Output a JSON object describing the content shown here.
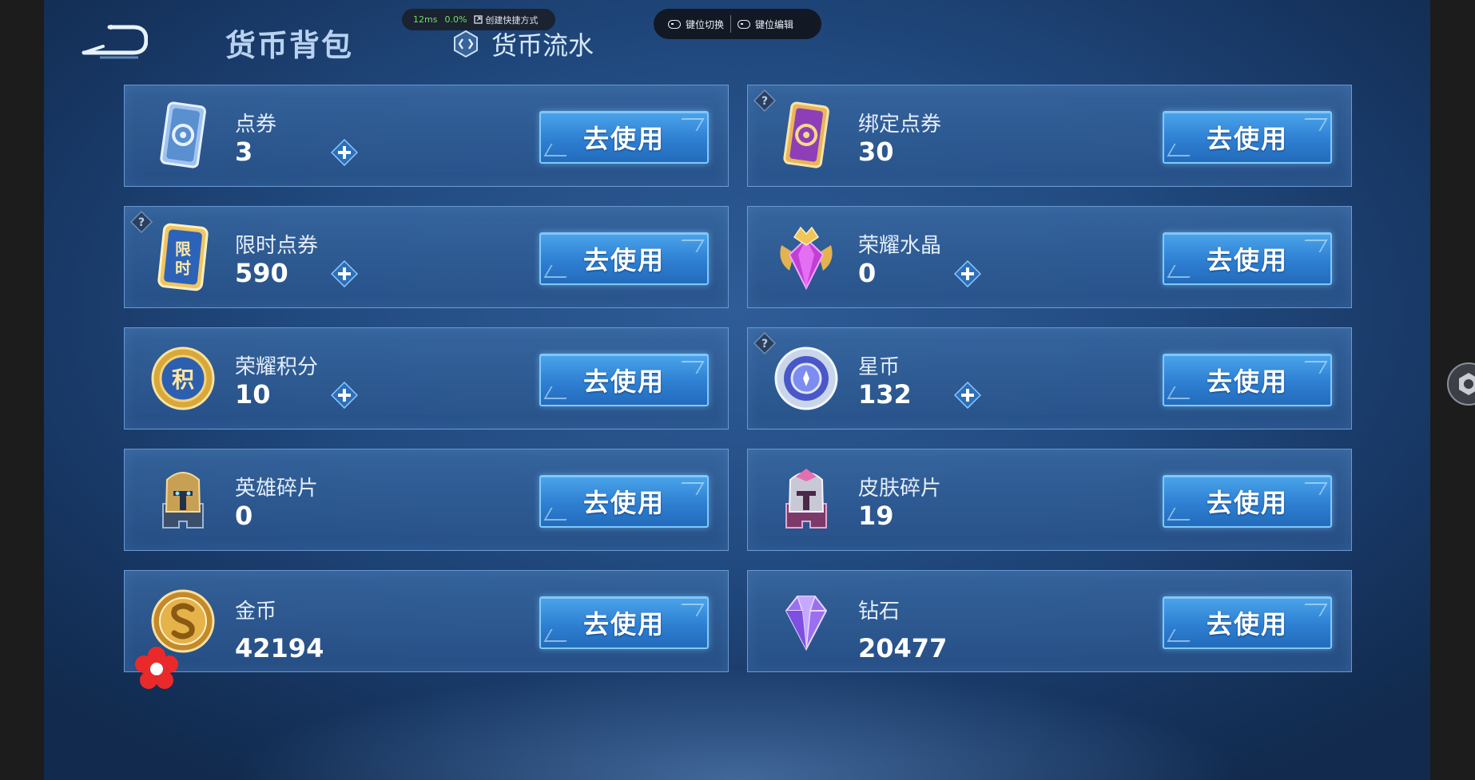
{
  "overlay": {
    "latency": "12ms",
    "cpu": "0.0%",
    "shortcut_label": "创建快捷方式",
    "key_switch_label": "键位切换",
    "key_edit_label": "键位编辑"
  },
  "header": {
    "title": "货币背包",
    "flow_tab_label": "货币流水"
  },
  "currencies": [
    {
      "name": "点券",
      "count": "3",
      "icon": "ticket-card-icon",
      "has_plus": true,
      "has_help": false
    },
    {
      "name": "绑定点券",
      "count": "30",
      "icon": "bound-ticket-card-icon",
      "has_plus": false,
      "has_help": true
    },
    {
      "name": "限时点券",
      "count": "590",
      "icon": "limited-ticket-icon",
      "has_plus": true,
      "has_help": true
    },
    {
      "name": "荣耀水晶",
      "count": "0",
      "icon": "glory-crystal-icon",
      "has_plus": true,
      "has_help": false
    },
    {
      "name": "荣耀积分",
      "count": "10",
      "icon": "glory-points-coin-icon",
      "has_plus": true,
      "has_help": false
    },
    {
      "name": "星币",
      "count": "132",
      "icon": "star-coin-icon",
      "has_plus": true,
      "has_help": true
    },
    {
      "name": "英雄碎片",
      "count": "0",
      "icon": "hero-fragment-icon",
      "has_plus": false,
      "has_help": false
    },
    {
      "name": "皮肤碎片",
      "count": "19",
      "icon": "skin-fragment-icon",
      "has_plus": false,
      "has_help": false
    },
    {
      "name": "金币",
      "count": "42194",
      "icon": "gold-coin-icon",
      "has_plus": false,
      "has_help": false
    },
    {
      "name": "钻石",
      "count": "20477",
      "icon": "diamond-icon",
      "has_plus": false,
      "has_help": false
    }
  ],
  "use_button_label": "去使用",
  "help_mark": "?",
  "limited_icon_text": "限时",
  "points_icon_text": "积",
  "colors": {
    "accent": "#4aa4ea",
    "card_border": "#7dafe6",
    "title": "#b9d2ef"
  }
}
